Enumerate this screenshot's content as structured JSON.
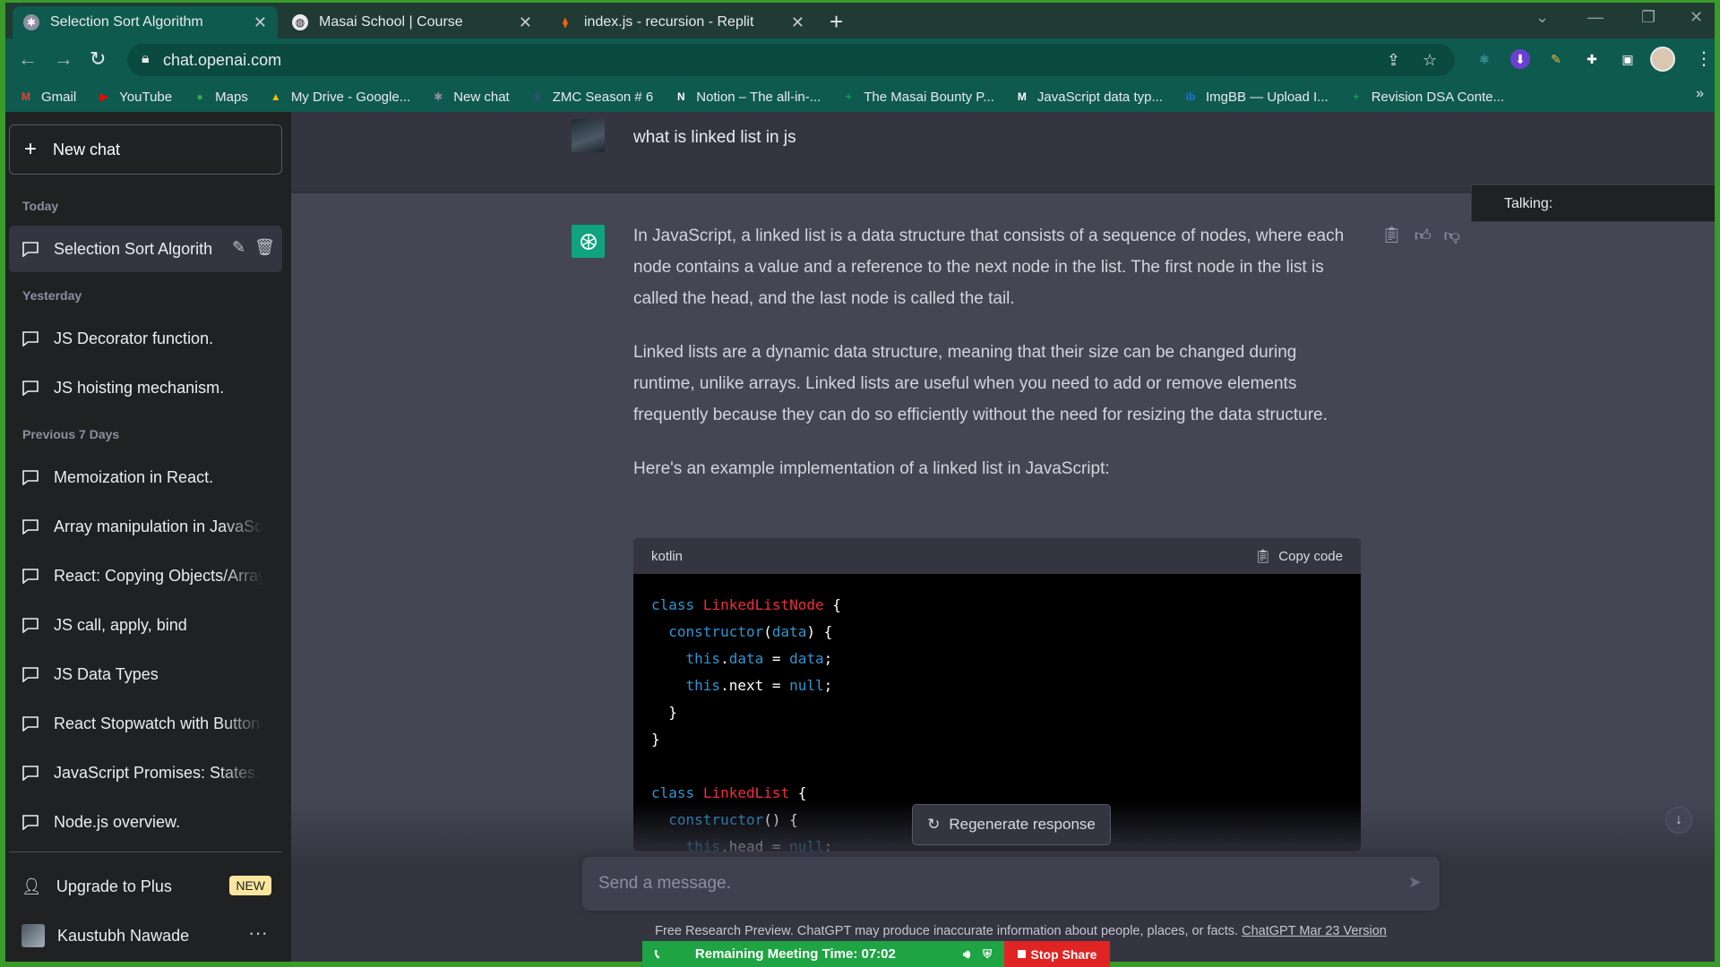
{
  "browser": {
    "tabs": [
      {
        "title": "Selection Sort Algorithm",
        "icon": "chatgpt-icon",
        "active": true
      },
      {
        "title": "Masai School | Course",
        "icon": "globe-icon",
        "active": false
      },
      {
        "title": "index.js - recursion - Replit",
        "icon": "replit-icon",
        "active": false
      }
    ],
    "url": "chat.openai.com",
    "bookmarks": [
      {
        "label": "Gmail",
        "icon": "gmail-icon",
        "color": "#ea4335",
        "glyph": "M"
      },
      {
        "label": "YouTube",
        "icon": "youtube-icon",
        "color": "#ff0000",
        "glyph": "▶"
      },
      {
        "label": "Maps",
        "icon": "maps-icon",
        "color": "#34a853",
        "glyph": "●"
      },
      {
        "label": "My Drive - Google...",
        "icon": "drive-icon",
        "color": "#fbbc04",
        "glyph": "▲"
      },
      {
        "label": "New chat",
        "icon": "chatgpt-icon",
        "color": "#8e8ea0",
        "glyph": "✱"
      },
      {
        "label": "ZMC Season # 6",
        "icon": "form-icon",
        "color": "#673ab7",
        "glyph": "≡"
      },
      {
        "label": "Notion – The all-in-...",
        "icon": "notion-icon",
        "color": "#ffffff",
        "glyph": "N"
      },
      {
        "label": "The Masai Bounty P...",
        "icon": "sheets-plus-icon",
        "color": "#0f9d58",
        "glyph": "+"
      },
      {
        "label": "JavaScript data typ...",
        "icon": "medium-icon",
        "color": "#ffffff",
        "glyph": "M"
      },
      {
        "label": "ImgBB — Upload I...",
        "icon": "imgbb-icon",
        "color": "#1a73e8",
        "glyph": "ib"
      },
      {
        "label": "Revision DSA Conte...",
        "icon": "sheets-plus-icon",
        "color": "#0f9d58",
        "glyph": "+"
      }
    ]
  },
  "sidebar": {
    "new_chat_label": "New chat",
    "sections": {
      "today": "Today",
      "yesterday": "Yesterday",
      "previous": "Previous 7 Days"
    },
    "today_items": [
      "Selection Sort Algorith"
    ],
    "yesterday_items": [
      "JS Decorator function.",
      "JS hoisting mechanism."
    ],
    "previous_items": [
      "Memoization in React.",
      "Array manipulation in JavaScri",
      "React: Copying Objects/Arrays",
      "JS call, apply, bind",
      "JS Data Types",
      "React Stopwatch with Buttons",
      "JavaScript Promises: States.",
      "Node.js overview."
    ],
    "upgrade_label": "Upgrade to Plus",
    "new_badge": "NEW",
    "user_name": "Kaustubh Nawade"
  },
  "conversation": {
    "user_message": "what is linked list in js",
    "assistant_paragraphs": [
      "In JavaScript, a linked list is a data structure that consists of a sequence of nodes, where each node contains a value and a reference to the next node in the list. The first node in the list is called the head, and the last node is called the tail.",
      "Linked lists are a dynamic data structure, meaning that their size can be changed during runtime, unlike arrays. Linked lists are useful when you need to add or remove elements frequently because they can do so efficiently without the need for resizing the data structure.",
      "Here's an example implementation of a linked list in JavaScript:"
    ],
    "code": {
      "language": "kotlin",
      "copy_label": "Copy code"
    }
  },
  "composer": {
    "placeholder": "Send a message.",
    "regenerate_label": "Regenerate response"
  },
  "footer": {
    "note": "Free Research Preview. ChatGPT may produce inaccurate information about people, places, or facts. ",
    "version_link": "ChatGPT Mar 23 Version"
  },
  "overlays": {
    "talking_label": "Talking:",
    "meeting_text": "Remaining Meeting Time: 07:02",
    "stop_share_label": "Stop Share"
  },
  "colors": {
    "sidebar_bg": "#202123",
    "main_bg": "#343541",
    "assistant_bg": "#444654",
    "accent": "#10a37f",
    "meeting_green": "#1fa443",
    "stop_red": "#e02323"
  }
}
